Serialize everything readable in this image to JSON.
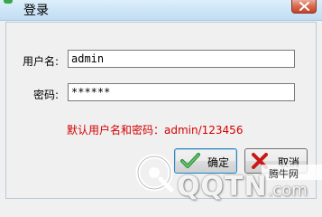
{
  "window": {
    "title": "登录"
  },
  "form": {
    "username_label": "用户名:",
    "username_value": "admin",
    "password_label": "密码:",
    "password_value": "******",
    "hint": "默认用户名和密码：admin/123456"
  },
  "buttons": {
    "ok_label": "确定",
    "cancel_label": "取消"
  },
  "watermark": {
    "site_name": "腾牛网",
    "logo_text": "QQTN",
    "logo_suffix": ".com"
  },
  "colors": {
    "hint": "#d40000",
    "titlebar": "#cfe6f7",
    "close_button": "#d7684f",
    "ok_icon": "#3aa64a",
    "cancel_icon": "#d02020"
  },
  "icons": {
    "close": "close-x-icon",
    "ok": "check-icon",
    "cancel": "cross-icon",
    "watermark": "qqtn-logo-icon"
  }
}
